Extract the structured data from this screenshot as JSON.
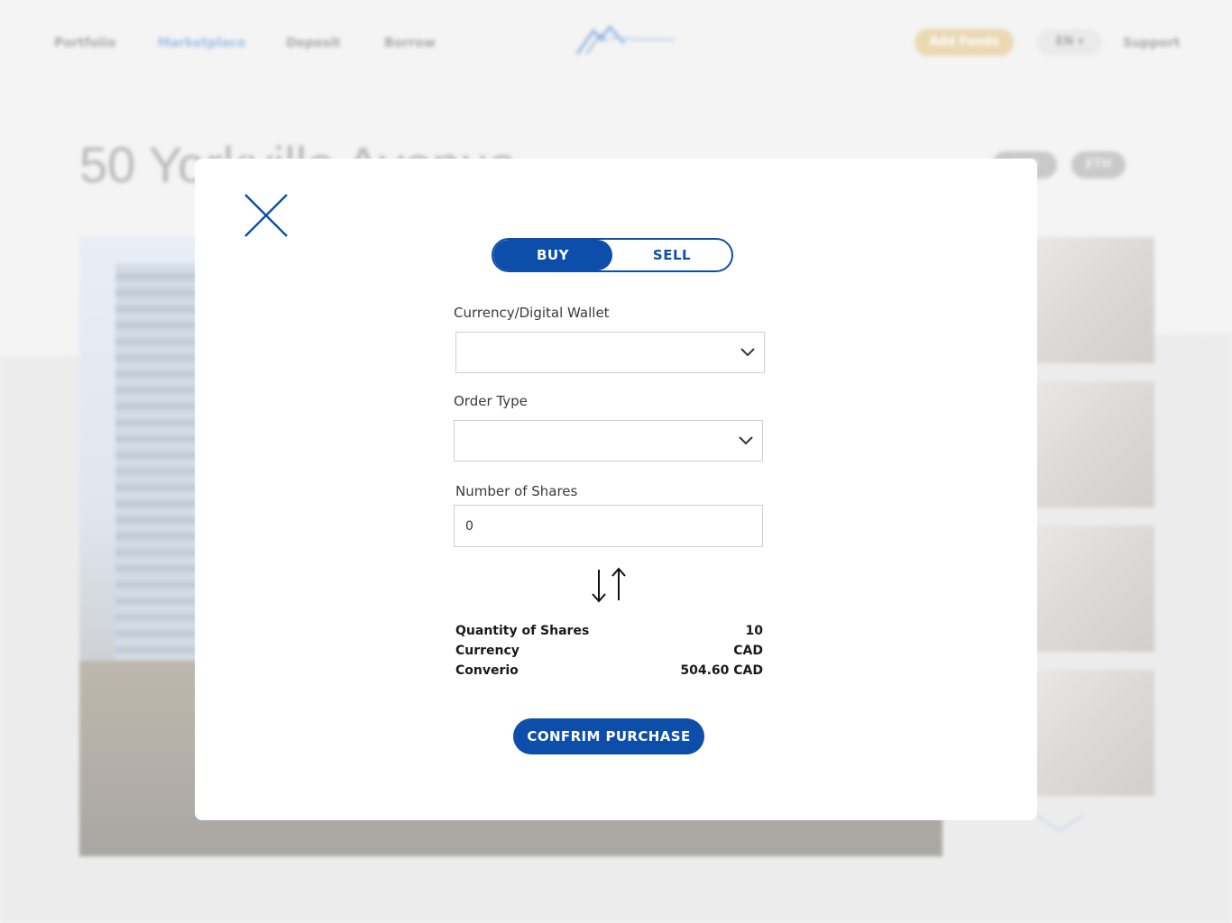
{
  "background": {
    "nav": {
      "links": [
        "Portfolio",
        "Marketplace",
        "Deposit",
        "Borrow"
      ],
      "active": "Marketplace",
      "add_funds": "Add Funds",
      "language": "EN ▾",
      "support": "Support"
    },
    "property_title": "50 Yorkville Avenue",
    "tokens": [
      "CAD",
      "ETH"
    ]
  },
  "modal": {
    "toggle": {
      "buy": "BUY",
      "sell": "SELL",
      "selected": "BUY"
    },
    "currency_label": "Currency/Digital Wallet",
    "currency_value": "",
    "order_type_label": "Order Type",
    "order_type_value": "",
    "shares_label": "Number of Shares",
    "shares_value": "0",
    "summary": [
      {
        "label": "Quantity of Shares",
        "value": "10"
      },
      {
        "label": "Currency",
        "value": "CAD"
      },
      {
        "label": "Converio",
        "value": "504.60 CAD"
      }
    ],
    "confirm_label": "CONFRIM PURCHASE"
  },
  "colors": {
    "primary": "#0d4eab",
    "add_funds_bg": "#ead9b3",
    "backdrop": "#f4f4f4"
  },
  "icons": {
    "close": "close-icon",
    "dropdown": "chevron-down-icon",
    "swap": "swap-arrows-icon",
    "logo": "mountain-logo"
  }
}
